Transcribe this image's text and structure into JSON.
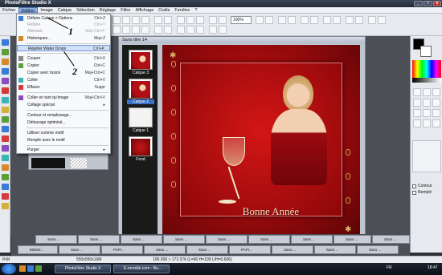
{
  "window": {
    "title": "PhotoFiltre Studio X"
  },
  "menubar": {
    "items": [
      "Fichier",
      "Edition",
      "Image",
      "Calque",
      "Sélection",
      "Réglage",
      "Filtre",
      "Affichage",
      "Outils",
      "Fenêtre",
      "?"
    ]
  },
  "edit_menu": {
    "items": [
      {
        "label": "Défaire Calque > Options",
        "shortcut": "Ctrl+Z",
        "disabled": false
      },
      {
        "label": "Refaire",
        "shortcut": "Ctrl+Y",
        "disabled": true
      },
      {
        "label": "Atténuer",
        "shortcut": "Maj+Ctrl+F",
        "disabled": true
      },
      {
        "label": "Historiques...",
        "shortcut": "Maj+Z",
        "disabled": false
      },
      {
        "label": "Répéter Water Drops",
        "shortcut": "Ctrl+K",
        "disabled": false,
        "highlighted": true
      },
      {
        "label": "Couper",
        "shortcut": "Ctrl+X",
        "disabled": false
      },
      {
        "label": "Copier",
        "shortcut": "Ctrl+C",
        "disabled": false
      },
      {
        "label": "Copier avec fusion",
        "shortcut": "Maj+Ctrl+C",
        "disabled": false
      },
      {
        "label": "Coller",
        "shortcut": "Ctrl+V",
        "disabled": false
      },
      {
        "label": "Effacer",
        "shortcut": "Suppr",
        "disabled": false
      },
      {
        "label": "Coller en tant qu'image",
        "shortcut": "Maj+Ctrl+V",
        "disabled": false
      },
      {
        "label": "Collage spécial",
        "shortcut": "",
        "disabled": false,
        "submenu": true
      },
      {
        "label": "Contour et remplissage...",
        "shortcut": "",
        "disabled": false
      },
      {
        "label": "Détourage optimisé...",
        "shortcut": "",
        "disabled": false
      },
      {
        "label": "Utiliser comme motif",
        "shortcut": "",
        "disabled": false
      },
      {
        "label": "Remplir avec le motif",
        "shortcut": "",
        "disabled": false
      },
      {
        "label": "Purger",
        "shortcut": "",
        "disabled": false,
        "submenu": true
      }
    ]
  },
  "document": {
    "title": "Sans titre 14",
    "canvas_text": "Bonne Année",
    "layers": [
      {
        "label": "Calque 3",
        "selected": false
      },
      {
        "label": "Calque 2",
        "selected": true
      },
      {
        "label": "Calque 1",
        "selected": false
      },
      {
        "label": "Fond",
        "selected": false
      }
    ]
  },
  "toolbar": {
    "zoom_value": "100%"
  },
  "right_panel": {
    "checkbox_contour": "Contour",
    "checkbox_remplir": "Remplir"
  },
  "annotations": {
    "a1": "1",
    "a2": "2",
    "a3": "13"
  },
  "statusbar": {
    "state": "Prêt",
    "size": "550x550x16M",
    "coords": "106:268 > 171:376 (L=66 H=109 L/H=0.606)"
  },
  "minimized_windows": [
    "Sans ...",
    "Sans ...",
    "Sans ...",
    "Sans ...",
    "Sans ...",
    "Sans ...",
    "Sans ...",
    "Sans ...",
    "Sans ...",
    "659SS...",
    "Sans ...",
    "PAPI...",
    "Sans ...",
    "Sans ...",
    "PAPI...",
    "Sans ...",
    "Sans ...",
    "Sans ..."
  ],
  "taskbar": {
    "items": [
      "PhotoFiltre Studio X",
      "E-morelle.com - Bo..."
    ],
    "language": "FR",
    "clock": "18:47"
  },
  "colors": {
    "accent": "#3b6fc9",
    "canvas_red": "#b40c0e",
    "menu_highlight": "#cfe0f7"
  }
}
